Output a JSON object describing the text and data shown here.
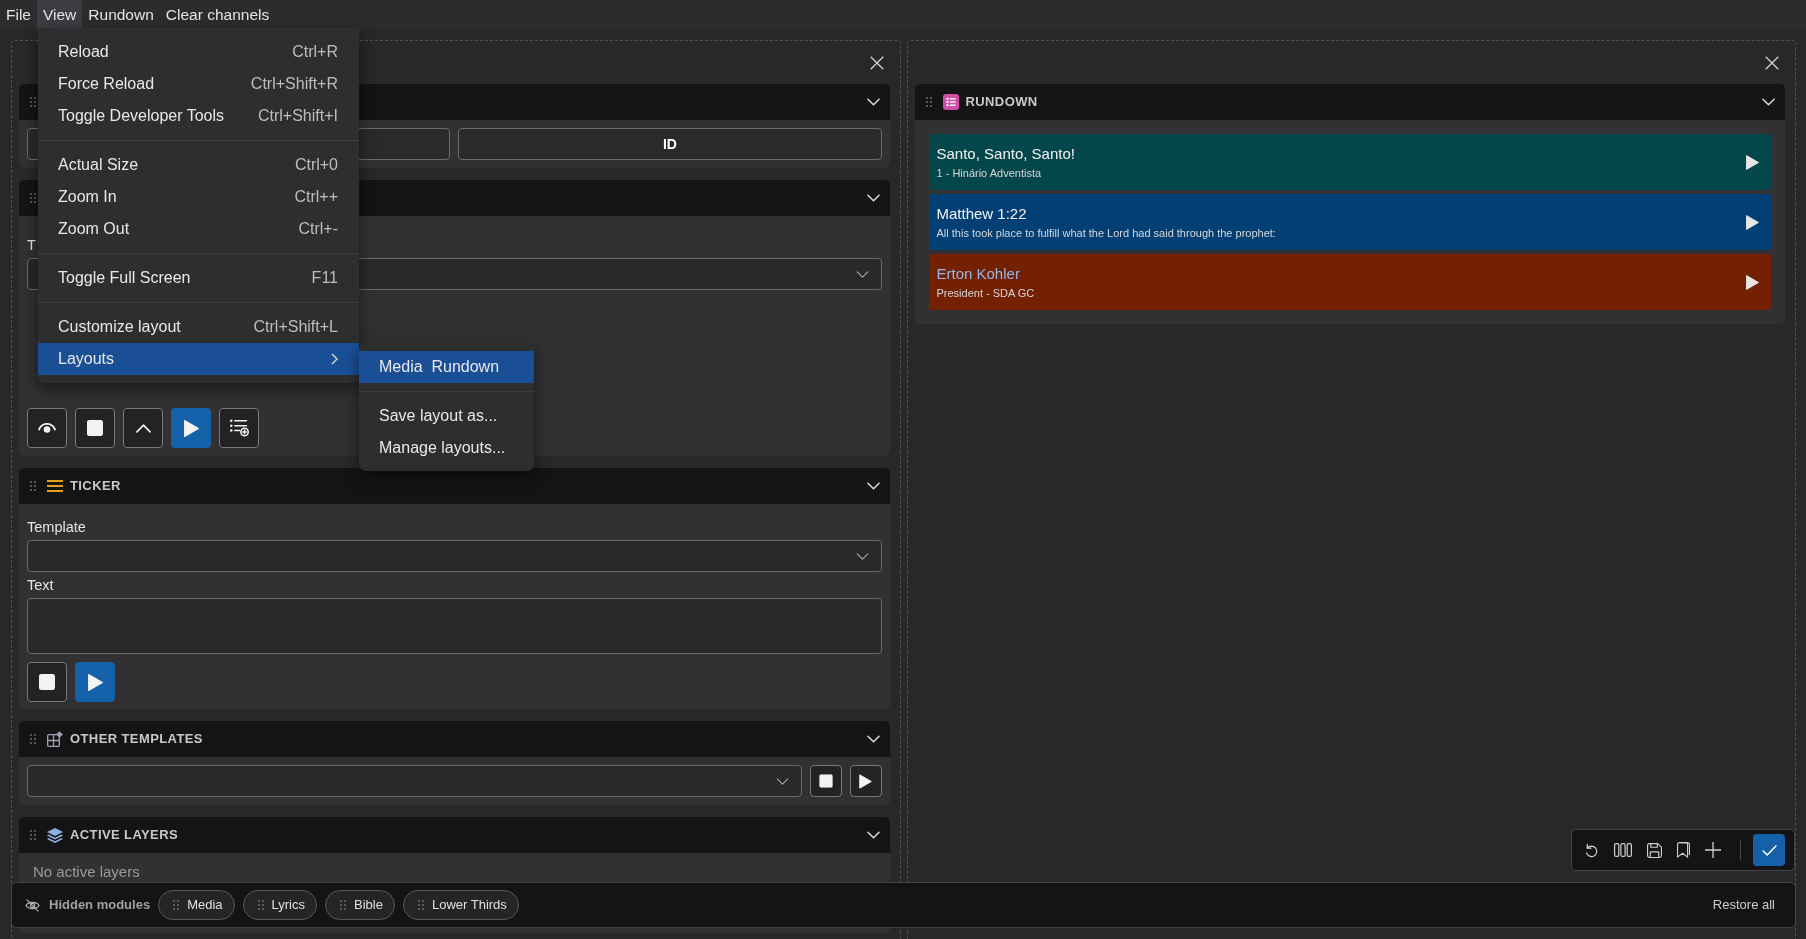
{
  "menubar": [
    {
      "label": "File",
      "selected": false
    },
    {
      "label": "View",
      "selected": true
    },
    {
      "label": "Rundown",
      "selected": false
    },
    {
      "label": "Clear channels",
      "selected": false
    }
  ],
  "view_menu": {
    "groups": [
      {
        "items": [
          {
            "kind": "command",
            "label": "Reload",
            "shortcut": "Ctrl+R",
            "selected": false
          },
          {
            "kind": "command",
            "label": "Force Reload",
            "shortcut": "Ctrl+Shift+R",
            "selected": false
          },
          {
            "kind": "command",
            "label": "Toggle Developer Tools",
            "shortcut": "Ctrl+Shift+I",
            "selected": false
          }
        ]
      },
      {
        "items": [
          {
            "kind": "command",
            "label": "Actual Size",
            "shortcut": "Ctrl+0",
            "selected": false
          },
          {
            "kind": "command",
            "label": "Zoom In",
            "shortcut": "Ctrl++",
            "selected": false
          },
          {
            "kind": "command",
            "label": "Zoom Out",
            "shortcut": "Ctrl+-",
            "selected": false
          }
        ]
      },
      {
        "items": [
          {
            "kind": "command",
            "label": "Toggle Full Screen",
            "shortcut": "F11",
            "selected": false
          }
        ]
      },
      {
        "items": [
          {
            "kind": "command",
            "label": "Customize layout",
            "shortcut": "Ctrl+Shift+L",
            "selected": false
          },
          {
            "kind": "submenu",
            "label": "Layouts",
            "selected": true
          }
        ]
      }
    ]
  },
  "layouts_menu": {
    "groups": [
      {
        "items": [
          {
            "label": "Media  Rundown",
            "selected": true
          }
        ]
      },
      {
        "items": [
          {
            "label": "Save layout as...",
            "selected": false
          },
          {
            "label": "Manage layouts...",
            "selected": false
          }
        ]
      }
    ]
  },
  "left_panel": {
    "sections": [
      {
        "kind": "channel",
        "buttons": [
          {
            "kind": "covered"
          },
          {
            "kind": "labeled",
            "label": "ID"
          }
        ]
      },
      {
        "kind": "graphics",
        "label": "T",
        "buttons": [
          {
            "kind": "eye",
            "primary": false
          },
          {
            "kind": "stop",
            "primary": false
          },
          {
            "kind": "up",
            "primary": false
          },
          {
            "kind": "play",
            "primary": true
          },
          {
            "kind": "add-list",
            "primary": false
          }
        ]
      },
      {
        "kind": "ticker",
        "title": "TICKER",
        "fields": [
          {
            "kind": "select",
            "label": "Template"
          },
          {
            "kind": "textarea",
            "label": "Text"
          }
        ],
        "buttons": [
          {
            "kind": "stop",
            "primary": false
          },
          {
            "kind": "play",
            "primary": true
          }
        ]
      },
      {
        "kind": "templates",
        "title": "OTHER TEMPLATES",
        "buttons": [
          {
            "kind": "stop",
            "primary": false
          },
          {
            "kind": "play",
            "primary": false
          }
        ]
      },
      {
        "kind": "layers",
        "title": "ACTIVE LAYERS",
        "message": "No active layers"
      }
    ]
  },
  "rundown": {
    "title": "RUNDOWN",
    "items": [
      {
        "title": "Santo, Santo, Santo!",
        "subtitle": "1 - Hinário Adventista",
        "color": "#03474a",
        "selected": false
      },
      {
        "title": "Matthew 1:22",
        "subtitle": "All this took place to fulfill what the Lord had said through the prophet:",
        "color": "#023f74",
        "selected": false
      },
      {
        "title": "Erton Kohler",
        "subtitle": "President - SDA GC",
        "color": "#732003",
        "selected": true
      }
    ]
  },
  "hidden_modules": {
    "title": "Hidden modules",
    "chips": [
      "Media",
      "Lyrics",
      "Bible",
      "Lower Thirds"
    ],
    "action": "Restore all"
  },
  "layout_toolbar": {
    "buttons": [
      {
        "kind": "undo"
      },
      {
        "kind": "columns"
      },
      {
        "kind": "save"
      },
      {
        "kind": "bookmark"
      },
      {
        "kind": "add"
      },
      {
        "kind": "confirm"
      }
    ]
  }
}
